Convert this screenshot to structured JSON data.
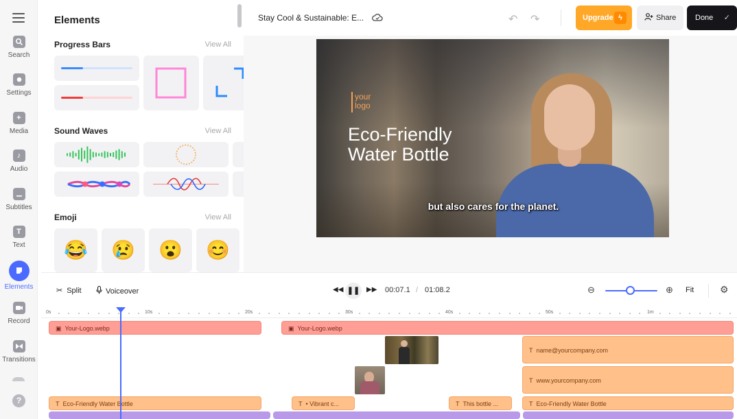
{
  "rail": {
    "items": [
      {
        "label": "Search",
        "icon": "search-icon"
      },
      {
        "label": "Settings",
        "icon": "settings-icon"
      },
      {
        "label": "Media",
        "icon": "plus-icon"
      },
      {
        "label": "Audio",
        "icon": "music-icon"
      },
      {
        "label": "Subtitles",
        "icon": "subtitles-icon"
      },
      {
        "label": "Text",
        "icon": "text-icon"
      },
      {
        "label": "Elements",
        "icon": "elements-icon"
      },
      {
        "label": "Record",
        "icon": "record-icon"
      },
      {
        "label": "Transitions",
        "icon": "transitions-icon"
      }
    ],
    "active": "Elements",
    "help_glyph": "?"
  },
  "panel": {
    "title": "Elements",
    "sections": [
      {
        "title": "Progress Bars",
        "view_all": "View All"
      },
      {
        "title": "Sound Waves",
        "view_all": "View All"
      },
      {
        "title": "Emoji",
        "view_all": "View All"
      }
    ],
    "emoji": [
      "😂",
      "😢",
      "😮",
      "😊"
    ]
  },
  "topbar": {
    "title": "Stay Cool & Sustainable: E...",
    "upgrade_label": "Upgrade",
    "share_label": "Share",
    "done_label": "Done"
  },
  "preview": {
    "logo_text": "your\nlogo",
    "headline": "Eco-Friendly\nWater Bottle",
    "caption": "but also cares for the planet."
  },
  "timeline": {
    "split_label": "Split",
    "voiceover_label": "Voiceover",
    "current_time": "00:07.1",
    "separator": "/",
    "duration": "01:08.2",
    "fit_label": "Fit",
    "ruler_labels": [
      "0s",
      "10s",
      "20s",
      "30s",
      "40s",
      "50s",
      "1m"
    ],
    "clips": {
      "logo_a": "Your-Logo.webp",
      "logo_b": "Your-Logo.webp",
      "email": "name@yourcompany.com",
      "website": "www.yourcompany.com",
      "title_a": "Eco-Friendly Water Bottle",
      "vibrant": "• Vibrant c...",
      "this_bottle": "This bottle ...",
      "title_b": "Eco-Friendly Water Bottle"
    }
  },
  "colors": {
    "accent": "#4b6bff",
    "upgrade": "#ffa727",
    "done": "#16161a",
    "clip_red": "#ff9e94",
    "clip_orange": "#ffc08a",
    "clip_purple": "#b89ae8"
  }
}
